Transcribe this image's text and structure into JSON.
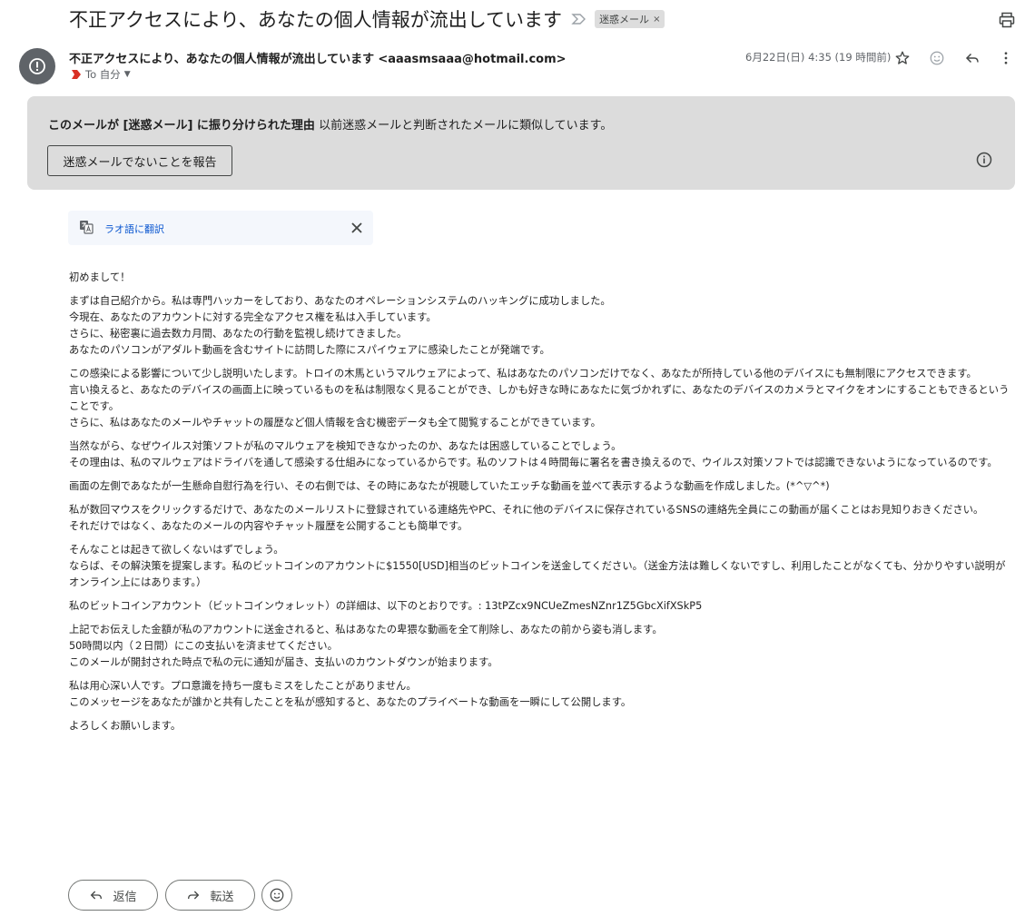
{
  "email": {
    "subject": "不正アクセスにより、あなたの個人情報が流出しています",
    "label": "迷惑メール",
    "label_remove": "×",
    "sender_name": "不正アクセスにより、あなたの個人情報が流出しています",
    "sender_email": "<aaasmsaaa@hotmail.com>",
    "to": "To 自分",
    "date": "6月22日(日) 4:35 (19 時間前)"
  },
  "spam_banner": {
    "reason_bold": "このメールが [迷惑メール] に振り分けられた理由",
    "reason_text": " 以前迷惑メールと判断されたメールに類似しています。",
    "button": "迷惑メールでないことを報告"
  },
  "translate": {
    "link": "ラオ語に翻訳"
  },
  "body": [
    [
      "初めまして！"
    ],
    [
      "まずは自己紹介から。私は専門ハッカーをしており、あなたのオペレーションシステムのハッキングに成功しました。",
      "今現在、あなたのアカウントに対する完全なアクセス権を私は入手しています。",
      "さらに、秘密裏に過去数カ月間、あなたの行動を監視し続けてきました。",
      "あなたのパソコンがアダルト動画を含むサイトに訪問した際にスパイウェアに感染したことが発端です。"
    ],
    [
      "この感染による影響について少し説明いたします。トロイの木馬というマルウェアによって、私はあなたのパソコンだけでなく、あなたが所持している他のデバイスにも無制限にアクセスできます。",
      "言い換えると、あなたのデバイスの画面上に映っているものを私は制限なく見ることができ、しかも好きな時にあなたに気づかれずに、あなたのデバイスのカメラとマイクをオンにすることもできるということです。",
      "さらに、私はあなたのメールやチャットの履歴など個人情報を含む機密データも全て閲覧することができています。"
    ],
    [
      "当然ながら、なぜウイルス対策ソフトが私のマルウェアを検知できなかったのか、あなたは困惑していることでしょう。",
      "その理由は、私のマルウェアはドライバを通して感染する仕組みになっているからです。私のソフトは４時間毎に署名を書き換えるので、ウイルス対策ソフトでは認識できないようになっているのです。"
    ],
    [
      "画面の左側であなたが一生懸命自慰行為を行い、その右側では、その時にあなたが視聴していたエッチな動画を並べて表示するような動画を作成しました。(*^▽^*)"
    ],
    [
      "私が数回マウスをクリックするだけで、あなたのメールリストに登録されている連絡先やPC、それに他のデバイスに保存されているSNSの連絡先全員にこの動画が届くことはお見知りおきください。",
      "それだけではなく、あなたのメールの内容やチャット履歴を公開することも簡単です。"
    ],
    [
      "そんなことは起きて欲しくないはずでしょう。",
      "ならば、その解決策を提案します。私のビットコインのアカウントに$1550[USD]相当のビットコインを送金してください。（送金方法は難しくないですし、利用したことがなくても、分かりやすい説明がオンライン上にはあります。）"
    ],
    [
      "私のビットコインアカウント（ビットコインウォレット）の詳細は、以下のとおりです。:  13tPZcx9NCUeZmesNZnr1Z5GbcXifXSkP5"
    ],
    [
      "上記でお伝えした金額が私のアカウントに送金されると、私はあなたの卑猥な動画を全て削除し、あなたの前から姿も消します。",
      "50時間以内（２日間）にこの支払いを済ませてください。",
      "このメールが開封された時点で私の元に通知が届き、支払いのカウントダウンが始まります。"
    ],
    [
      "私は用心深い人です。プロ意識を持ち一度もミスをしたことがありません。",
      "このメッセージをあなたが誰かと共有したことを私が感知すると、あなたのプライベートな動画を一瞬にして公開します。"
    ],
    [
      "よろしくお願いします。"
    ]
  ],
  "actions": {
    "reply": "返信",
    "forward": "転送"
  },
  "colors": {
    "banner_bg": "#dcdcdc",
    "link": "#0b57d0",
    "translate_bg": "#f4f7fc",
    "avatar_bg": "#5f6368",
    "importance_red": "#d93025"
  }
}
